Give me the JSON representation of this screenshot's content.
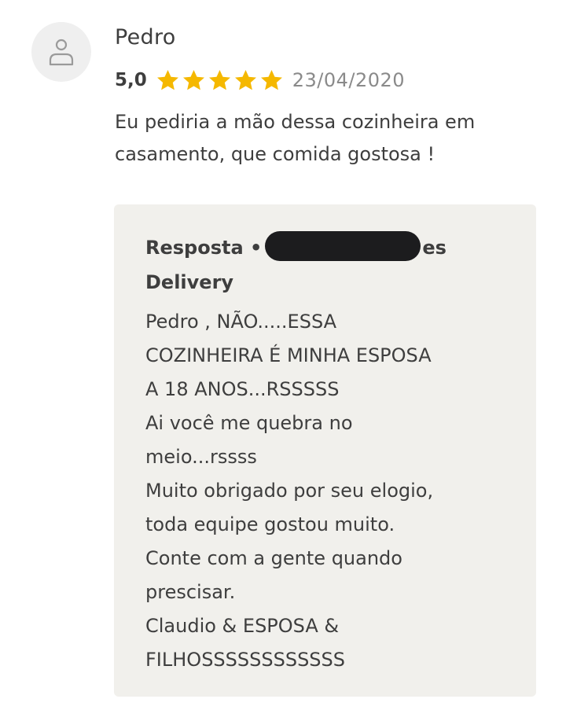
{
  "review": {
    "author": "Pedro",
    "rating": "5,0",
    "stars": 5,
    "star_color": "#f5b800",
    "date": "23/04/2020",
    "text": "Eu pediria a mão dessa cozinheira em casamento, que comida gostosa !"
  },
  "reply": {
    "label": "Resposta",
    "separator": "•",
    "merchant_suffix": "es",
    "merchant_line2": "Delivery",
    "text": "Pedro , NÃO.....ESSA\nCOZINHEIRA É MINHA ESPOSA\nA 18 ANOS...RSSSSS\nAi você me quebra no\nmeio...rssss\nMuito obrigado por seu elogio,\ntoda equipe gostou muito.\nConte com a gente quando\nprescisar.\nClaudio & ESPOSA &\nFILHOSSSSSSSSSSSS"
  },
  "icons": {
    "avatar": "user-icon",
    "star": "star-icon"
  }
}
